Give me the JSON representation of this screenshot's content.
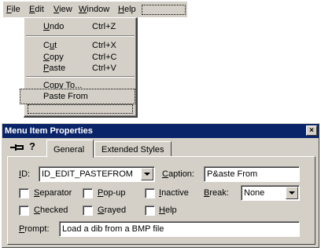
{
  "menubar": {
    "items": [
      "File",
      "Edit",
      "View",
      "Window",
      "Help"
    ]
  },
  "dropdown": {
    "undo": {
      "label": "Undo",
      "accel": "Ctrl+Z"
    },
    "cut": {
      "label": "Cut",
      "accel": "Ctrl+X"
    },
    "copy": {
      "label": "Copy",
      "accel": "Ctrl+C"
    },
    "paste": {
      "label": "Paste",
      "accel": "Ctrl+V"
    },
    "copy_to": {
      "label": "Copy To..."
    },
    "paste_from": {
      "label": "Paste From"
    }
  },
  "dialog": {
    "title": "Menu Item Properties",
    "close_glyph": "×",
    "help_glyph": "?",
    "tabs": [
      "General",
      "Extended Styles"
    ],
    "id_label": "ID:",
    "id_value": "ID_EDIT_PASTEFROM",
    "caption_label": "Caption:",
    "caption_value": "P&aste From",
    "separator_label": "Separator",
    "popup_label": "Pop-up",
    "inactive_label": "Inactive",
    "break_label": "Break:",
    "break_value": "None",
    "checked_label": "Checked",
    "grayed_label": "Grayed",
    "help_label": "Help",
    "prompt_label": "Prompt:",
    "prompt_value": "Load a dib from a BMP file"
  },
  "colors": {
    "face": "#d4d0c8",
    "titlebar": "#0a246a",
    "titlebar_text": "#ffffff"
  },
  "icons": {
    "pin": "pushpin-icon",
    "help": "help-icon",
    "close": "close-icon",
    "dropdown": "chevron-down-icon"
  }
}
